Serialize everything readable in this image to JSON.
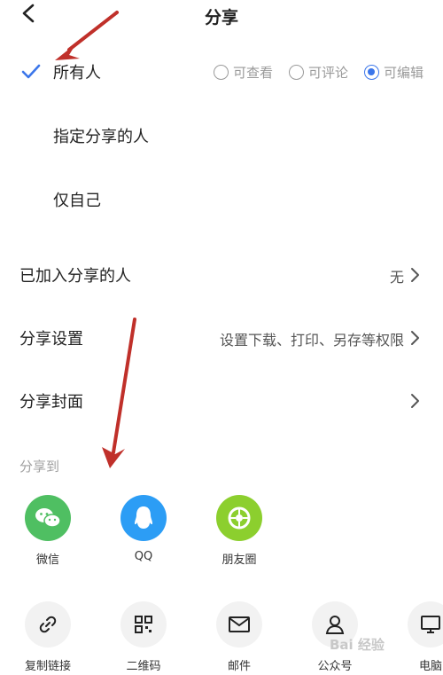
{
  "header": {
    "title": "分享"
  },
  "permissions": [
    {
      "label": "所有人",
      "checked": true
    },
    {
      "label": "指定分享的人",
      "checked": false
    },
    {
      "label": "仅自己",
      "checked": false
    }
  ],
  "access_options": [
    {
      "label": "可查看",
      "selected": false
    },
    {
      "label": "可评论",
      "selected": false
    },
    {
      "label": "可编辑",
      "selected": true
    }
  ],
  "rows": {
    "joined": {
      "label": "已加入分享的人",
      "value": "无"
    },
    "settings": {
      "label": "分享设置",
      "value": "设置下载、打印、另存等权限"
    },
    "cover": {
      "label": "分享封面",
      "value": ""
    }
  },
  "share_to": {
    "title": "分享到",
    "apps": [
      {
        "label": "微信",
        "color": "#4fbf62",
        "icon": "wechat-icon"
      },
      {
        "label": "QQ",
        "color": "#2c9df5",
        "icon": "qq-icon"
      },
      {
        "label": "朋友圈",
        "color": "#8ccf2e",
        "icon": "moments-icon"
      }
    ]
  },
  "tools": [
    {
      "label": "复制链接",
      "icon": "link-icon"
    },
    {
      "label": "二维码",
      "icon": "qrcode-icon"
    },
    {
      "label": "邮件",
      "icon": "mail-icon"
    },
    {
      "label": "公众号",
      "icon": "person-icon"
    },
    {
      "label": "电脑",
      "icon": "computer-icon"
    }
  ],
  "watermark": "Bai 经验",
  "colors": {
    "accent": "#3b76ea",
    "annotation_arrow": "#c0302a"
  }
}
